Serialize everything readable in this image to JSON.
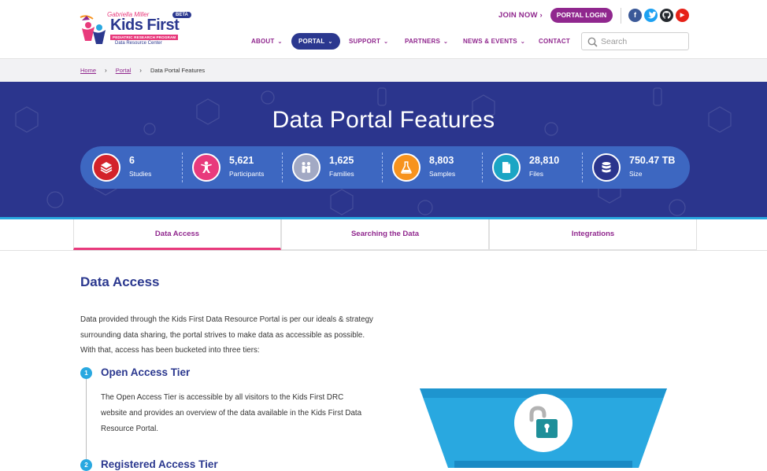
{
  "header": {
    "logo": {
      "byline": "Gabriella Miller",
      "beta": "BETA",
      "title": "Kids First",
      "program": "PEDIATRIC RESEARCH PROGRAM",
      "subtitle": "Data Resource Center"
    },
    "join_now": "JOIN NOW ›",
    "portal_login": "PORTAL LOGIN",
    "social": [
      {
        "icon": "facebook-icon",
        "glyph": "f",
        "color": "#3b5998"
      },
      {
        "icon": "twitter-icon",
        "glyph": "t",
        "color": "#1da1f2"
      },
      {
        "icon": "github-icon",
        "glyph": "",
        "color": "#24292e"
      },
      {
        "icon": "youtube-icon",
        "glyph": "▶",
        "color": "#e62117"
      }
    ],
    "nav": [
      {
        "label": "ABOUT",
        "active": false
      },
      {
        "label": "PORTAL",
        "active": true
      },
      {
        "label": "SUPPORT",
        "active": false
      },
      {
        "label": "PARTNERS",
        "active": false
      },
      {
        "label": "NEWS & EVENTS",
        "active": false
      },
      {
        "label": "CONTACT",
        "active": false
      }
    ],
    "search_placeholder": "Search"
  },
  "breadcrumb": {
    "items": [
      "Home",
      "Portal"
    ],
    "current": "Data Portal Features"
  },
  "hero": {
    "title": "Data Portal Features",
    "stats": [
      {
        "value": "6",
        "label": "Studies",
        "icon": "studies-stack-icon",
        "color": "#d3222a"
      },
      {
        "value": "5,621",
        "label": "Participants",
        "icon": "participant-icon",
        "color": "#e83a7c"
      },
      {
        "value": "1,625",
        "label": "Families",
        "icon": "family-icon",
        "color": "#a2a9c4"
      },
      {
        "value": "8,803",
        "label": "Samples",
        "icon": "flask-icon",
        "color": "#f7931e"
      },
      {
        "value": "28,810",
        "label": "Files",
        "icon": "file-icon",
        "color": "#1ba5c4"
      },
      {
        "value": "750.47 TB",
        "label": "Size",
        "icon": "database-icon",
        "color": "#2b358d"
      }
    ]
  },
  "tabs": [
    {
      "label": "Data Access",
      "active": true
    },
    {
      "label": "Searching the Data",
      "active": false
    },
    {
      "label": "Integrations",
      "active": false
    }
  ],
  "content": {
    "heading": "Data Access",
    "intro": "Data provided through the Kids First Data Resource Portal is per our ideals & strategy surrounding data sharing, the portal strives to make data as accessible as possible. With that, access has been bucketed into three tiers:",
    "tiers": [
      {
        "number": "1",
        "title": "Open Access Tier",
        "description": "The Open Access Tier is accessible by all visitors to the Kids First DRC website and provides an overview of the data available in the Kids First Data Resource Portal."
      },
      {
        "number": "2",
        "title": "Registered Access Tier"
      }
    ]
  },
  "colors": {
    "brand_purple": "#90278e",
    "brand_navy": "#2b388f",
    "accent_pink": "#e83a7c",
    "accent_blue": "#29a8e0",
    "lock_teal": "#1e8f99"
  }
}
